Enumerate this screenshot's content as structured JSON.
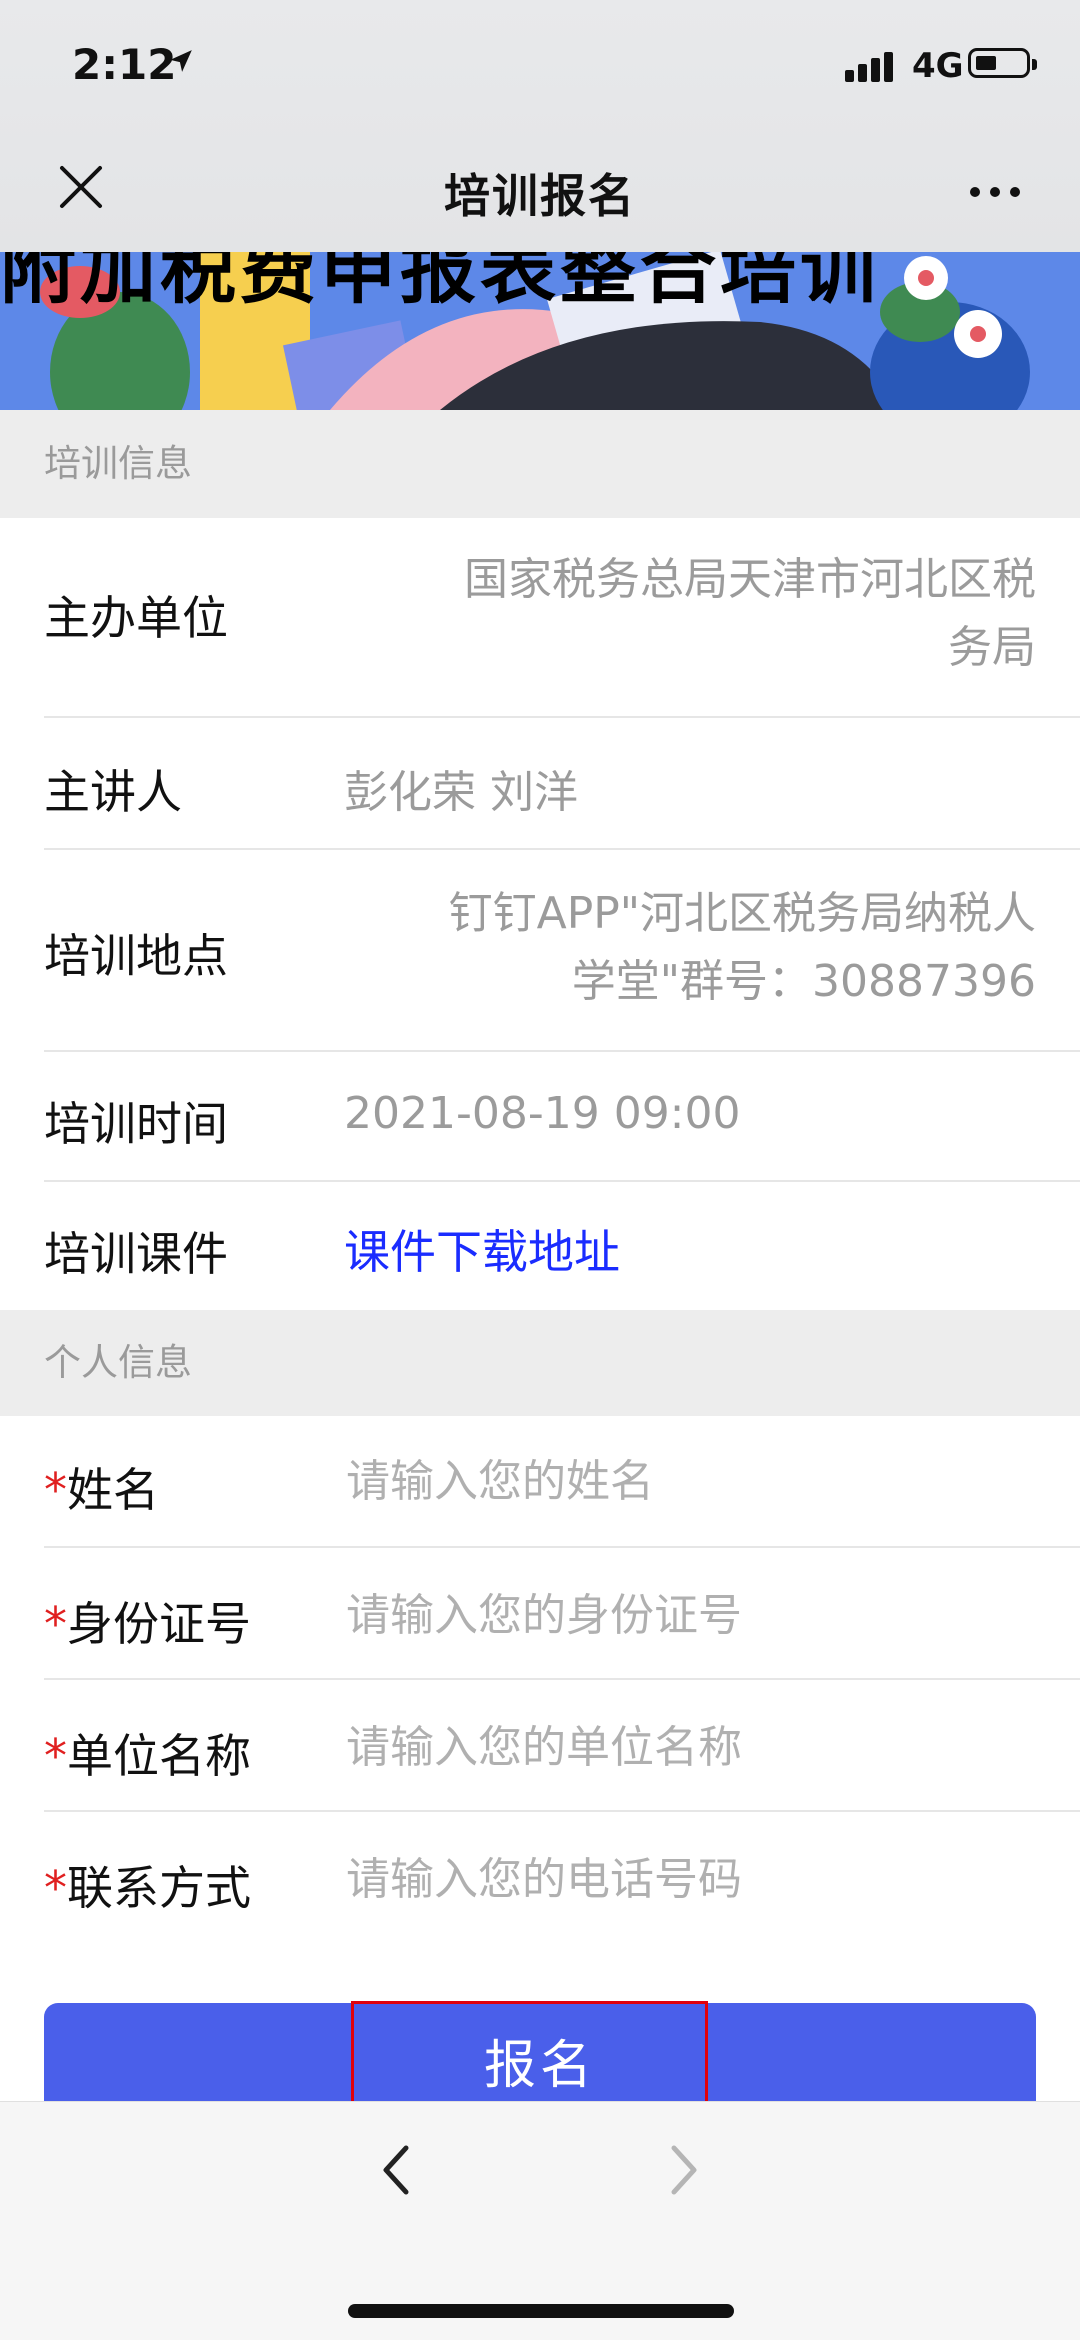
{
  "status_bar": {
    "time": "2:12",
    "network": "4G"
  },
  "nav": {
    "title": "培训报名",
    "close_icon": "close-icon",
    "more_icon": "more-icon"
  },
  "banner": {
    "text": "附加税费申报表整合培训"
  },
  "training_section": {
    "header": "培训信息",
    "rows": [
      {
        "label": "主办单位",
        "value_line1": "国家税务总局天津市河北区税",
        "value_line2": "务局"
      },
      {
        "label": "主讲人",
        "value": "彭化荣 刘洋"
      },
      {
        "label": "培训地点",
        "value_line1": "钉钉APP\"河北区税务局纳税人",
        "value_line2": "学堂\"群号：30887396"
      },
      {
        "label": "培训时间",
        "value": "2021-08-19 09:00"
      },
      {
        "label": "培训课件",
        "link": "课件下载地址"
      }
    ]
  },
  "personal_section": {
    "header": "个人信息",
    "fields": [
      {
        "required_mark": "*",
        "label": "姓名",
        "placeholder": "请输入您的姓名"
      },
      {
        "required_mark": "*",
        "label": "身份证号",
        "placeholder": "请输入您的身份证号"
      },
      {
        "required_mark": "*",
        "label": "单位名称",
        "placeholder": "请输入您的单位名称"
      },
      {
        "required_mark": "*",
        "label": "联系方式",
        "placeholder": "请输入您的电话号码"
      }
    ]
  },
  "submit": {
    "label": "报名"
  },
  "colors": {
    "accent": "#4a5fea",
    "link": "#1a2cff",
    "required": "#e02020",
    "highlight": "#e0000c"
  }
}
